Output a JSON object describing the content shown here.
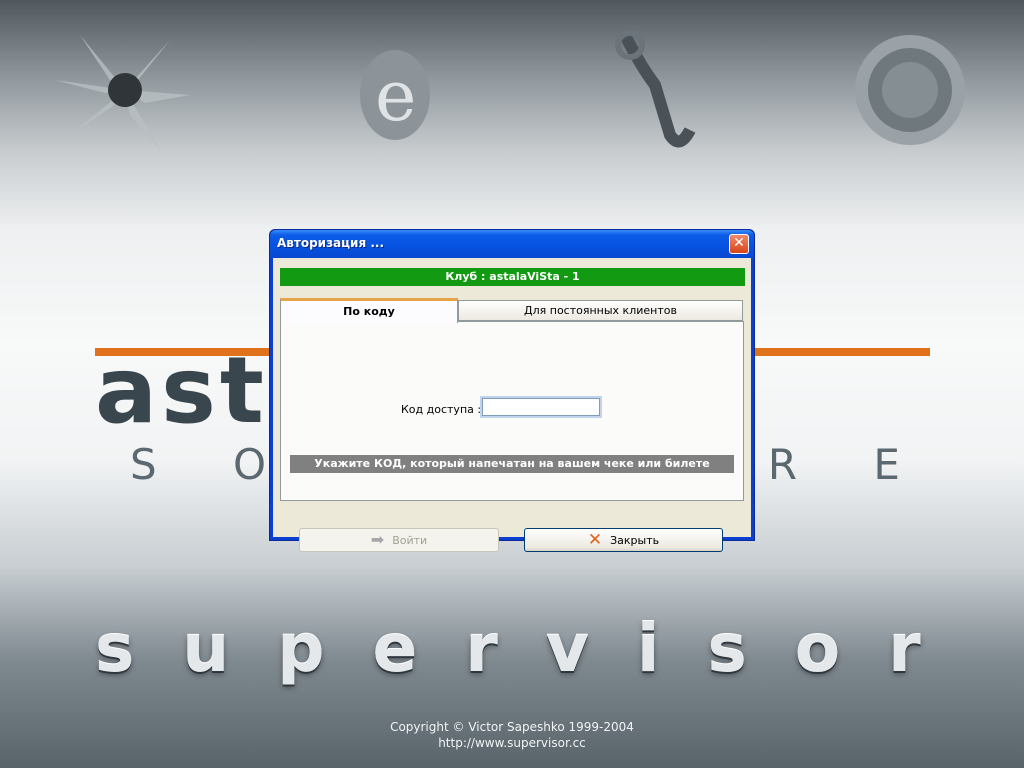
{
  "window": {
    "title": "Авторизация ...",
    "close_symbol": "✕"
  },
  "club_bar": {
    "text": "Клуб : astalaViSta - 1"
  },
  "tabs": [
    {
      "label": "По коду",
      "active": true
    },
    {
      "label": "Для постоянных клиентов",
      "active": false
    }
  ],
  "form": {
    "code_label": "Код доступа :",
    "code_value": ""
  },
  "hint": {
    "text": "Укажите КОД, который напечатан на вашем чеке или билете"
  },
  "buttons": {
    "login_label": "Войти",
    "login_enabled": false,
    "close_label": "Закрыть"
  },
  "wallpaper": {
    "brand_word": "astalavista",
    "brand_sub_letters": [
      "S",
      "O",
      "F",
      "T",
      "W",
      "A",
      "R",
      "E"
    ],
    "product": "supervisor",
    "copyright": "Copyright © Victor Sapeshko 1999-2004",
    "url": "http://www.supervisor.cc"
  },
  "colors": {
    "title_blue": "#0551e0",
    "club_green": "#129a12",
    "hint_gray": "#808080",
    "accent_orange": "#e0721c"
  }
}
